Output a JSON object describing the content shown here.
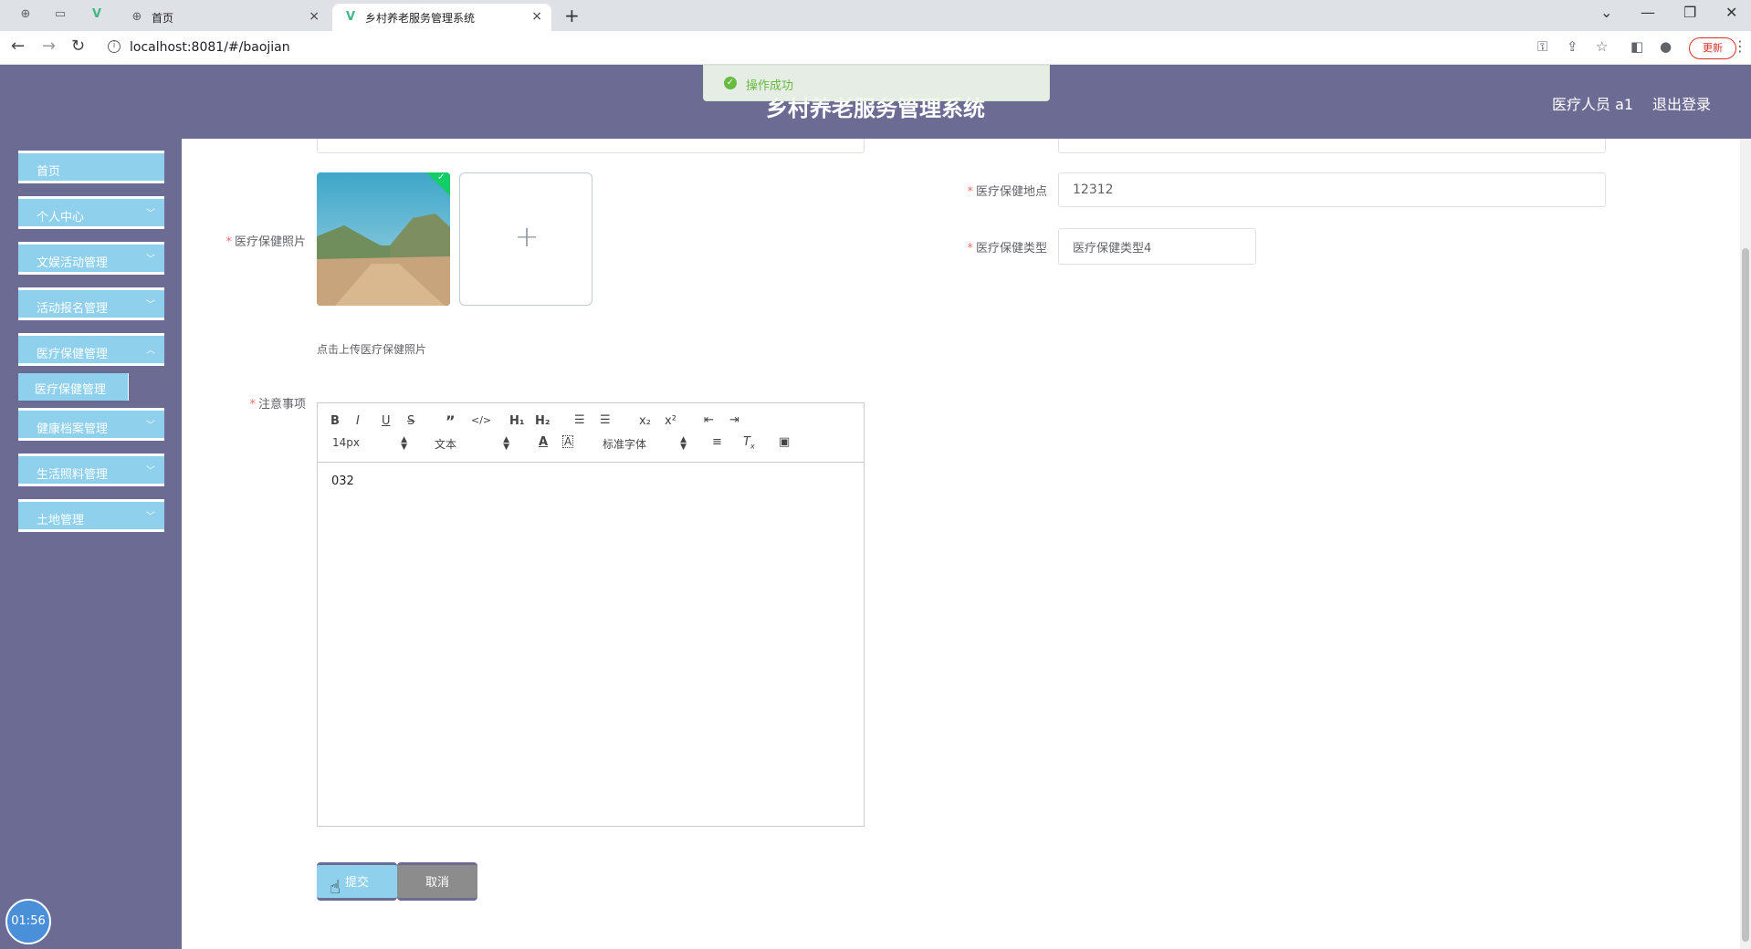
{
  "browser": {
    "tabs": [
      {
        "title": "首页",
        "close": "×"
      },
      {
        "title": "乡村养老服务管理系统",
        "close": "×"
      }
    ],
    "new_tab": "+",
    "url": "localhost:8081/#/baojian",
    "update_label": "更新",
    "icons": [
      "globe-icon",
      "page-icon",
      "vue-icon",
      "back-icon",
      "forward-icon",
      "reload-icon",
      "info-icon",
      "key-icon",
      "share-icon",
      "star-icon",
      "sidepanel-icon",
      "profile-icon",
      "menu-icon"
    ]
  },
  "header": {
    "title": "乡村养老服务管理系统",
    "user": "医疗人员 a1",
    "logout": "退出登录"
  },
  "toast": {
    "message": "操作成功",
    "color": "#67c23a"
  },
  "sidebar": {
    "items": [
      {
        "label": "首页"
      },
      {
        "label": "个人中心"
      },
      {
        "label": "文娱活动管理"
      },
      {
        "label": "活动报名管理"
      },
      {
        "label": "医疗保健管理"
      },
      {
        "label": "健康档案管理"
      },
      {
        "label": "生活照料管理"
      },
      {
        "label": "土地管理"
      }
    ],
    "active_sub": "医疗保健管理",
    "timer": "01:56"
  },
  "form": {
    "photo_label": "医疗保健照片",
    "upload_hint": "点击上传医疗保健照片",
    "location_label": "医疗保健地点",
    "location_value": "12312",
    "type_label": "医疗保健类型",
    "type_value": "医疗保健类型4",
    "notes_label": "注意事项",
    "editor": {
      "font_size": "14px",
      "paragraph": "文本",
      "font_family": "标准字体",
      "content": "032"
    },
    "submit": "提交",
    "cancel": "取消"
  },
  "colors": {
    "header_bg": "#6c6b94",
    "sidebar_bg": "#6c6b94",
    "menu_item_bg": "#8fd0ec",
    "required": "#f56c6c"
  }
}
